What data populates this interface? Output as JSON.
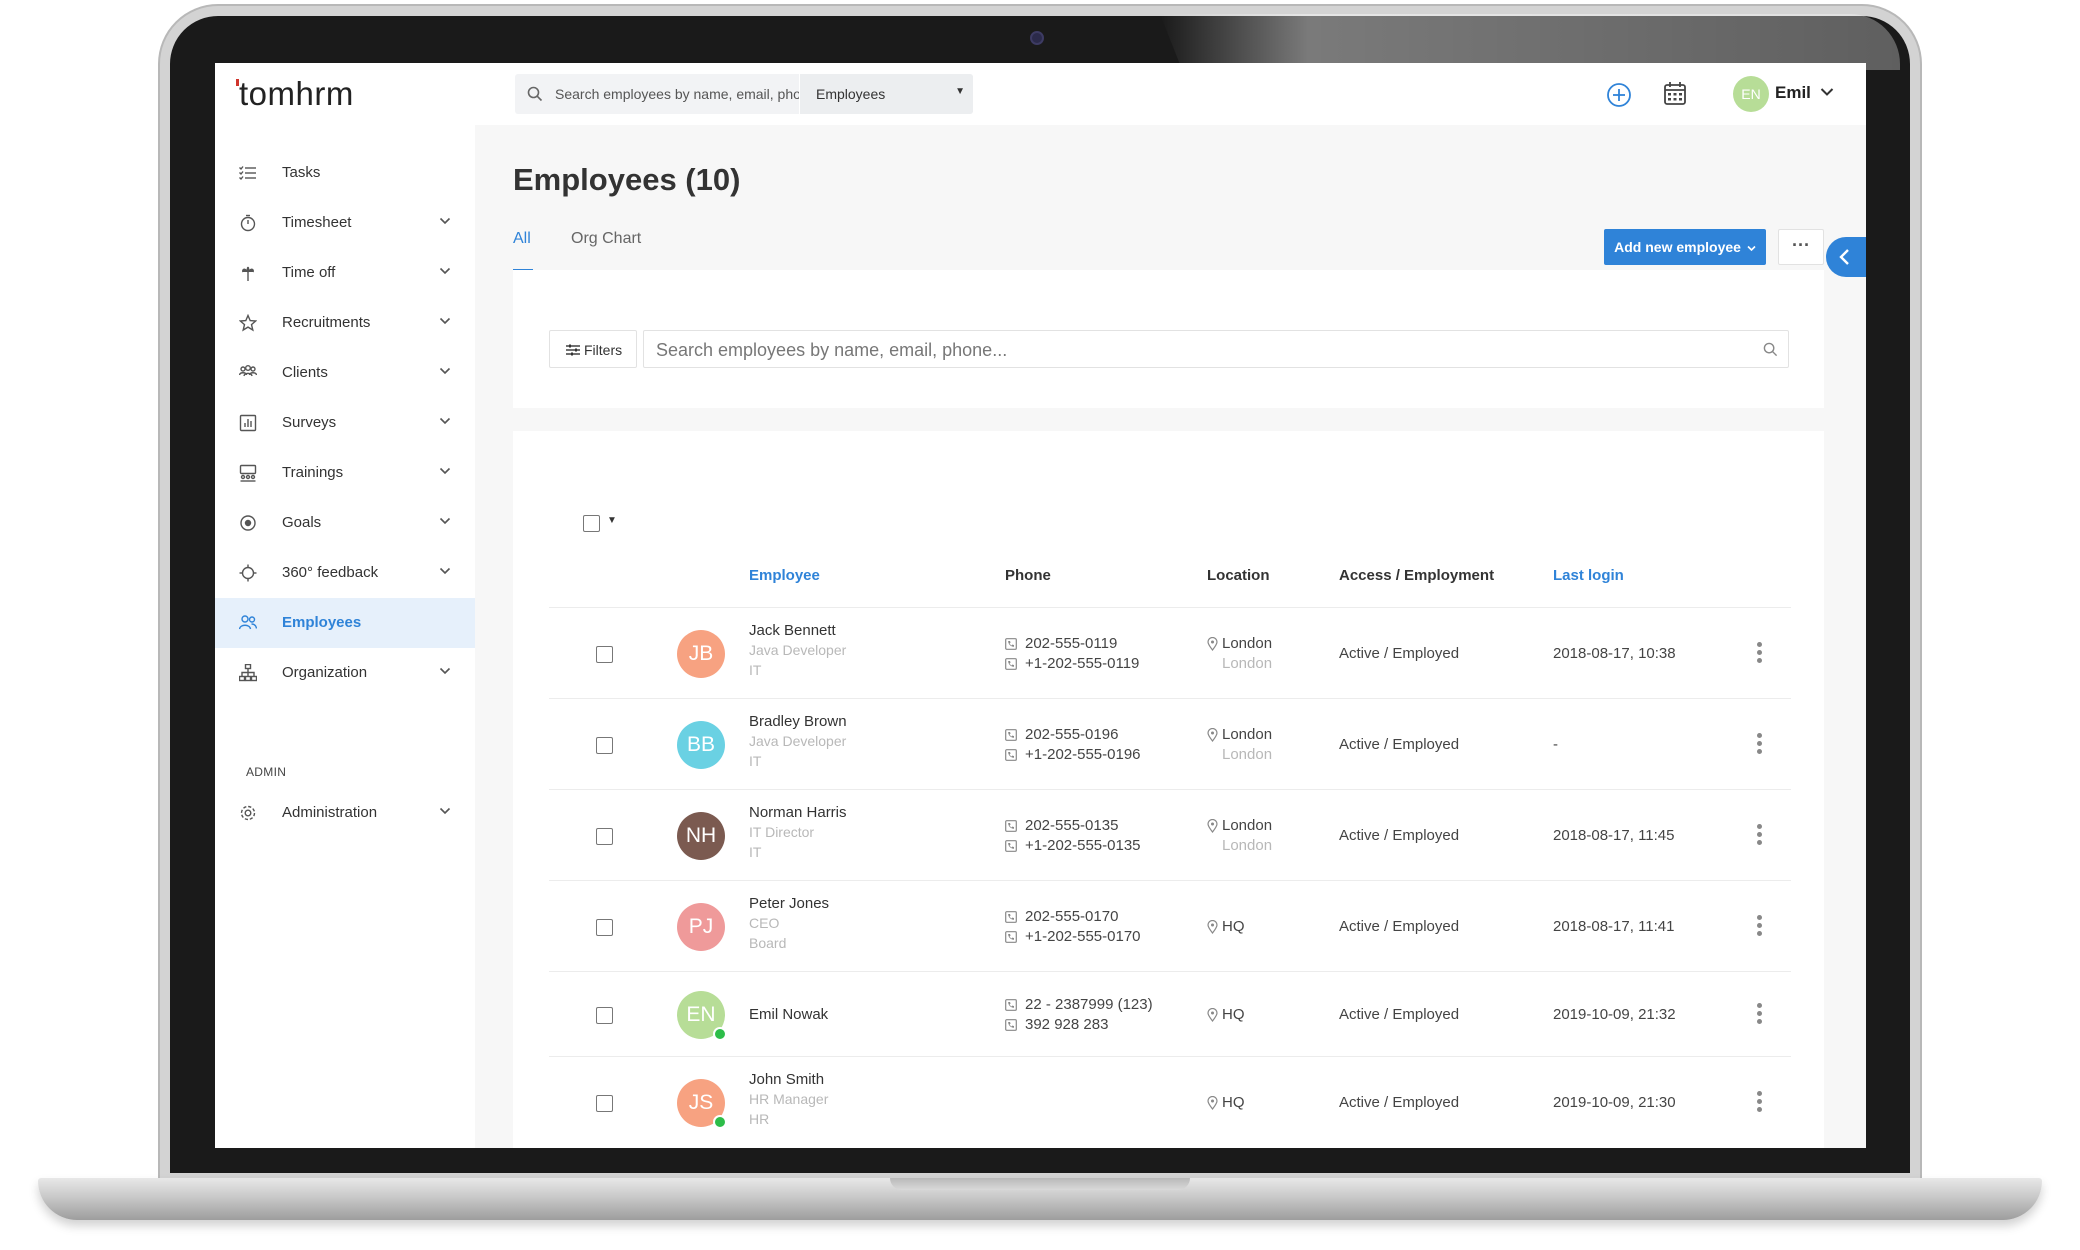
{
  "app": {
    "logo": "tomhrm"
  },
  "header": {
    "search_placeholder": "Search employees by name, email, phone...",
    "scope_value": "Employees",
    "user_initials": "EN",
    "user_name": "Emil"
  },
  "sidebar": {
    "items": [
      {
        "label": "Tasks",
        "icon": "tasks-icon",
        "has_chevron": false
      },
      {
        "label": "Timesheet",
        "icon": "stopwatch-icon",
        "has_chevron": true
      },
      {
        "label": "Time off",
        "icon": "palm-tree-icon",
        "has_chevron": true
      },
      {
        "label": "Recruitments",
        "icon": "star-icon",
        "has_chevron": true
      },
      {
        "label": "Clients",
        "icon": "clients-icon",
        "has_chevron": true
      },
      {
        "label": "Surveys",
        "icon": "bar-chart-icon",
        "has_chevron": true
      },
      {
        "label": "Trainings",
        "icon": "training-icon",
        "has_chevron": true
      },
      {
        "label": "Goals",
        "icon": "target-icon",
        "has_chevron": true
      },
      {
        "label": "360° feedback",
        "icon": "feedback-icon",
        "has_chevron": true
      },
      {
        "label": "Employees",
        "icon": "people-icon",
        "has_chevron": false,
        "active": true
      },
      {
        "label": "Organization",
        "icon": "org-chart-icon",
        "has_chevron": true
      }
    ],
    "admin_section_label": "ADMIN",
    "admin_items": [
      {
        "label": "Administration",
        "icon": "gear-icon",
        "has_chevron": true
      }
    ]
  },
  "main": {
    "title": "Employees (10)",
    "tabs": [
      {
        "label": "All",
        "active": true
      },
      {
        "label": "Org Chart",
        "active": false
      }
    ],
    "add_button_label": "Add new employee",
    "more_button_label": "···",
    "filters_label": "Filters",
    "search_placeholder": "Search employees by name, email, phone..."
  },
  "table": {
    "columns": [
      "Employee",
      "Phone",
      "Location",
      "Access / Employment",
      "Last login"
    ],
    "rows": [
      {
        "initials": "JB",
        "avatar_color": "#f7a281",
        "online": false,
        "name": "Jack Bennett",
        "position": "Java Developer",
        "department": "IT",
        "phones": [
          "202-555-0119",
          "+1-202-555-0119"
        ],
        "location": "London",
        "location_sub": "London",
        "access": "Active / Employed",
        "last_login": "2018-08-17, 10:38"
      },
      {
        "initials": "BB",
        "avatar_color": "#6ad1e3",
        "online": false,
        "name": "Bradley Brown",
        "position": "Java Developer",
        "department": "IT",
        "phones": [
          "202-555-0196",
          "+1-202-555-0196"
        ],
        "location": "London",
        "location_sub": "London",
        "access": "Active / Employed",
        "last_login": "-"
      },
      {
        "initials": "NH",
        "avatar_color": "#7b5a50",
        "online": false,
        "name": "Norman Harris",
        "position": "IT Director",
        "department": "IT",
        "phones": [
          "202-555-0135",
          "+1-202-555-0135"
        ],
        "location": "London",
        "location_sub": "London",
        "access": "Active / Employed",
        "last_login": "2018-08-17, 11:45"
      },
      {
        "initials": "PJ",
        "avatar_color": "#ef9a9a",
        "online": false,
        "name": "Peter Jones",
        "position": "CEO",
        "department": "Board",
        "phones": [
          "202-555-0170",
          "+1-202-555-0170"
        ],
        "location": "HQ",
        "location_sub": "",
        "access": "Active / Employed",
        "last_login": "2018-08-17, 11:41"
      },
      {
        "initials": "EN",
        "avatar_color": "#b7dd97",
        "online": true,
        "name": "Emil Nowak",
        "position": "",
        "department": "",
        "phones": [
          "22 - 2387999 (123)",
          "392 928 283"
        ],
        "location": "HQ",
        "location_sub": "",
        "access": "Active / Employed",
        "last_login": "2019-10-09, 21:32"
      },
      {
        "initials": "JS",
        "avatar_color": "#f7a281",
        "online": true,
        "name": "John Smith",
        "position": "HR Manager",
        "department": "HR",
        "phones": [],
        "location": "HQ",
        "location_sub": "",
        "access": "Active / Employed",
        "last_login": "2019-10-09, 21:30"
      }
    ]
  },
  "colors": {
    "accent": "#2f83d8",
    "online": "#2dbd49"
  }
}
